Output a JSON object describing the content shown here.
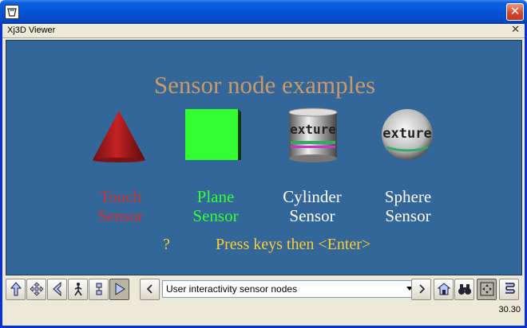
{
  "window": {
    "tab_title": "Xj3D Viewer",
    "close_glyph": "✕",
    "tab_close_glyph": "✕"
  },
  "scene": {
    "title": "Sensor node examples",
    "labels": [
      {
        "line1": "Touch",
        "line2": "Sensor",
        "color": "#cc3333"
      },
      {
        "line1": "Plane",
        "line2": "Sensor",
        "color": "#33ff33"
      },
      {
        "line1": "Cylinder",
        "line2": "Sensor",
        "color": "#ffffff"
      },
      {
        "line1": "Sphere",
        "line2": "Sensor",
        "color": "#ffffff"
      }
    ],
    "hint_question": "?",
    "hint_text": "Press keys then <Enter>",
    "texture_word": "exture"
  },
  "toolbar": {
    "viewpoint_select": "User interactivity sensor nodes",
    "prev_glyph": "«",
    "next_glyph": "»",
    "left_buttons": [
      "fly-icon",
      "pan-icon",
      "tilt-icon",
      "walk-icon",
      "examine-icon",
      "play-icon"
    ],
    "right_buttons": [
      "home-icon",
      "binoculars-icon",
      "fit-icon",
      "scroll-icon"
    ]
  },
  "status": {
    "fps": "30.30"
  },
  "colors": {
    "canvas_bg": "#336699",
    "title": "#cc9966",
    "hint": "#ffcc33"
  }
}
